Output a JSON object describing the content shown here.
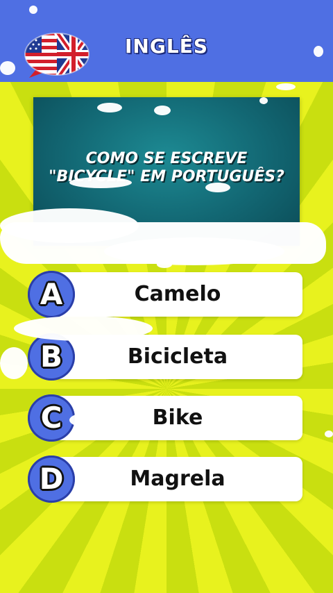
{
  "header": {
    "title": "INGLÊS",
    "flag_icon": "usa-uk-flag-speech-bubble-icon"
  },
  "question": {
    "line1": "COMO SE ESCREVE",
    "line2": "\"BICYCLE\" EM PORTUGUÊS?"
  },
  "answers": [
    {
      "letter": "A",
      "text": "Camelo"
    },
    {
      "letter": "B",
      "text": "Bicicleta"
    },
    {
      "letter": "C",
      "text": "Bike"
    },
    {
      "letter": "D",
      "text": "Magrela"
    }
  ],
  "colors": {
    "header_bg": "#4f6fe3",
    "background_yellow": "#d8ea1a",
    "panel_teal": "#126672",
    "answer_bg": "#ffffff"
  }
}
